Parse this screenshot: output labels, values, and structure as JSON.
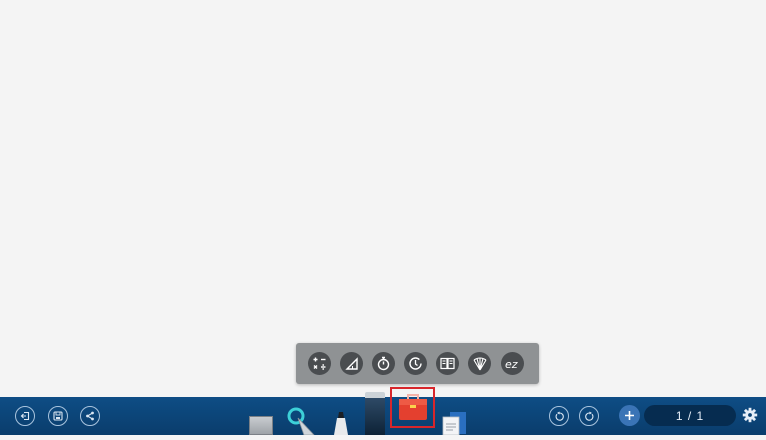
{
  "canvas": {
    "background": "#f4f4f4"
  },
  "tools_popup": {
    "items": [
      {
        "name": "calculator",
        "icon": "calculator-icon"
      },
      {
        "name": "ruler",
        "icon": "triangle-ruler-icon"
      },
      {
        "name": "stopwatch",
        "icon": "stopwatch-icon"
      },
      {
        "name": "timer",
        "icon": "timer-icon"
      },
      {
        "name": "split-screen",
        "icon": "split-screen-icon"
      },
      {
        "name": "fan",
        "icon": "fan-icon"
      },
      {
        "name": "ez",
        "icon": "ez-icon",
        "label": "ez"
      }
    ]
  },
  "bottom_bar": {
    "left_buttons": [
      {
        "name": "exit",
        "icon": "exit-icon"
      },
      {
        "name": "save",
        "icon": "save-icon"
      },
      {
        "name": "share",
        "icon": "share-icon"
      }
    ],
    "center_tools": [
      {
        "name": "paper",
        "icon": "paper-icon"
      },
      {
        "name": "pointer",
        "icon": "pointer-icon"
      },
      {
        "name": "pen",
        "icon": "pen-icon"
      },
      {
        "name": "eraser",
        "icon": "eraser-icon"
      },
      {
        "name": "toolbox",
        "icon": "toolbox-icon",
        "selected": true
      },
      {
        "name": "document",
        "icon": "document-icon"
      }
    ],
    "right_buttons": [
      {
        "name": "undo",
        "icon": "undo-icon"
      },
      {
        "name": "redo",
        "icon": "redo-icon"
      },
      {
        "name": "add-page",
        "icon": "plus-icon"
      }
    ],
    "page_indicator": "1 / 1",
    "settings_icon": "gear-icon",
    "colors": {
      "bar": "#0c4578",
      "highlight": "#d8262b",
      "toolbox": "#e4402f"
    }
  }
}
